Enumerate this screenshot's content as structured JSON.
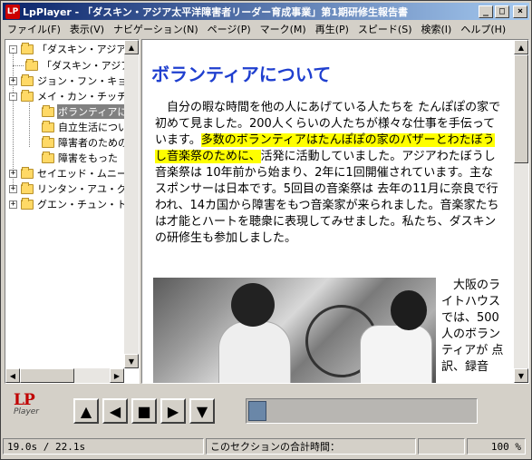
{
  "window": {
    "title": "LpPlayer - 「ダスキン・アジア太平洋障害者リーダー育成事業」第1期研修生報告書",
    "app_icon_text": "LP",
    "controls": {
      "minimize": "_",
      "maximize": "□",
      "close": "×"
    }
  },
  "menu": [
    "ファイル(F)",
    "表示(V)",
    "ナビゲーション(N)",
    "ページ(P)",
    "マーク(M)",
    "再生(P)",
    "スピード(S)",
    "検索(I)",
    "ヘルプ(H)"
  ],
  "tree": {
    "items": [
      {
        "label": "「ダスキン・アジア太",
        "expander": "-"
      },
      {
        "label": "「ダスキン・アジア",
        "expander": ""
      },
      {
        "label": "ジョン・フン・キョン",
        "expander": "+"
      },
      {
        "label": "メイ・カン・チッチャ",
        "expander": "-"
      },
      {
        "label": "ボランティアについて",
        "expander": "",
        "selected": true
      },
      {
        "label": "自立生活について",
        "expander": ""
      },
      {
        "label": "障害者のための",
        "expander": ""
      },
      {
        "label": "障害をもった",
        "expander": ""
      },
      {
        "label": "セイエッド・ムニール",
        "expander": "+"
      },
      {
        "label": "リンタン・アユ・グン",
        "expander": "+"
      },
      {
        "label": "グエン・チュン・トゥ",
        "expander": "+"
      }
    ]
  },
  "content": {
    "heading": "ボランティアについて",
    "para_before": "　自分の暇な時間を他の人にあげている人たちを たんぽぽの家で初めて見ました。200人くらいの人たちが様々な仕事を手伝っています。",
    "para_highlight": "多数のボランティアはたんぽぽの家のバザーとわたぼうし音楽祭のために、",
    "para_after": "活発に活動していました。アジアわたぼうし音楽祭は 10年前から始まり、2年に1回開催されています。主なスポンサーは日本です。5回目の音楽祭は 去年の11月に奈良で行われ、14カ国から障害をもつ音楽家が来られました。音楽家たちは才能とハートを聴衆に表現してみせました。私たち、ダスキンの研修生も参加しました。",
    "side_text": "　大阪のライトハウスでは、500人のボランティアが 点訳、録音"
  },
  "toolbar": {
    "logo_text": "LP",
    "logo_sub": "Player",
    "buttons": {
      "up": "▲",
      "back": "◀",
      "stop": "■",
      "forward": "▶",
      "down": "▼"
    },
    "progress_fraction": 0.08
  },
  "status": {
    "time": "19.0s / 22.1s",
    "section_label": "このセクションの合計時間：",
    "section_value": "",
    "zoom": "100 %"
  },
  "colors": {
    "heading": "#1f3fcf",
    "highlight": "#ffff00",
    "titlebar_start": "#0a246a",
    "titlebar_end": "#a6caf0"
  }
}
